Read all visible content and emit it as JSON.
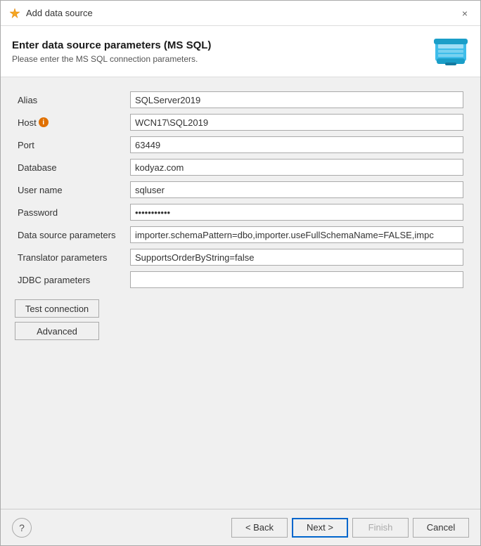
{
  "dialog": {
    "title": "Add data source",
    "close_label": "×"
  },
  "header": {
    "heading": "Enter data source parameters (MS SQL)",
    "subtext": "Please enter the MS SQL connection parameters."
  },
  "form": {
    "alias_label": "Alias",
    "alias_value": "SQLServer2019",
    "host_label": "Host",
    "host_info": "i",
    "host_value": "WCN17\\SQL2019",
    "port_label": "Port",
    "port_value": "63449",
    "database_label": "Database",
    "database_value": "kodyaz.com",
    "username_label": "User name",
    "username_value": "sqluser",
    "password_label": "Password",
    "password_value": "••••••••",
    "datasource_params_label": "Data source parameters",
    "datasource_params_value": "importer.schemaPattern=dbo,importer.useFullSchemaName=FALSE,impc",
    "translator_params_label": "Translator parameters",
    "translator_params_value": "SupportsOrderByString=false",
    "jdbc_params_label": "JDBC parameters",
    "jdbc_params_value": ""
  },
  "buttons": {
    "test_connection": "Test connection",
    "advanced": "Advanced"
  },
  "footer": {
    "help_label": "?",
    "back_label": "< Back",
    "next_label": "Next >",
    "finish_label": "Finish",
    "cancel_label": "Cancel"
  }
}
